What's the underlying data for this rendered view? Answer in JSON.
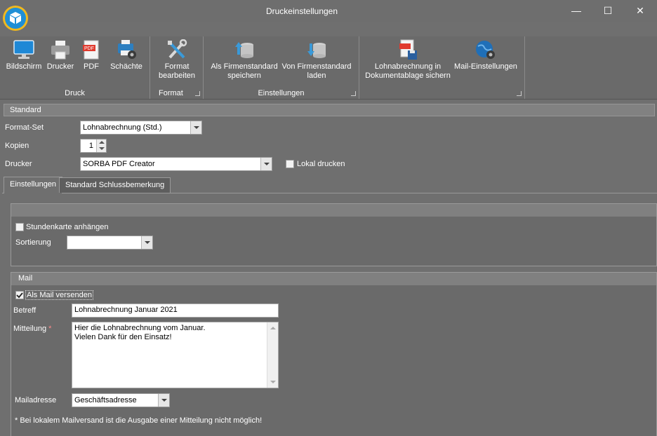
{
  "window": {
    "title": "Druckeinstellungen",
    "minimize": "—",
    "maximize": "☐",
    "close": "✕"
  },
  "ribbon": {
    "groups": {
      "druck": "Druck",
      "format": "Format",
      "einstellungen": "Einstellungen"
    },
    "buttons": {
      "bildschirm": "Bildschirm",
      "drucker": "Drucker",
      "pdf": "PDF",
      "schaechte": "Schächte",
      "format_bearbeiten_1": "Format",
      "format_bearbeiten_2": "bearbeiten",
      "als_firmenstandard_1": "Als Firmenstandard",
      "als_firmenstandard_2": "speichern",
      "von_firmenstandard_1": "Von Firmenstandard",
      "von_firmenstandard_2": "laden",
      "lohnabrechnung_1": "Lohnabrechnung in",
      "lohnabrechnung_2": "Dokumentablage sichern",
      "mail_einstellungen": "Mail-Einstellungen"
    },
    "pdf_icon_text": "PDF"
  },
  "standard": {
    "header": "Standard",
    "format_set_label": "Format-Set",
    "format_set_value": "Lohnabrechnung (Std.)",
    "kopien_label": "Kopien",
    "kopien_value": "1",
    "drucker_label": "Drucker",
    "drucker_value": "SORBA PDF Creator",
    "lokal_drucken_label": "Lokal drucken",
    "lokal_drucken_checked": false
  },
  "tabs": [
    {
      "label": "Einstellungen",
      "active": true
    },
    {
      "label": "Standard Schlussbemerkung",
      "active": false
    }
  ],
  "einstellungen": {
    "stundenkarte_label": "Stundenkarte anhängen",
    "stundenkarte_checked": false,
    "sortierung_label": "Sortierung",
    "sortierung_value": ""
  },
  "mail": {
    "header": "Mail",
    "als_mail_label": "Als Mail versenden",
    "als_mail_checked": true,
    "betreff_label": "Betreff",
    "betreff_value": "Lohnabrechnung Januar 2021",
    "mitteilung_label": "Mitteilung",
    "mitteilung_required": "*",
    "mitteilung_line1": "Hier die Lohnabrechnung vom Januar.",
    "mitteilung_line2": "Vielen Dank für den Einsatz!",
    "mailadresse_label": "Mailadresse",
    "mailadresse_value": "Geschäftsadresse",
    "hinweis": "* Bei lokalem Mailversand ist die Ausgabe einer Mitteilung nicht möglich!"
  },
  "colors": {
    "background": "#6f6f6f",
    "accent_blue": "#1f8fd6",
    "required_star": "#ff8a8a"
  }
}
